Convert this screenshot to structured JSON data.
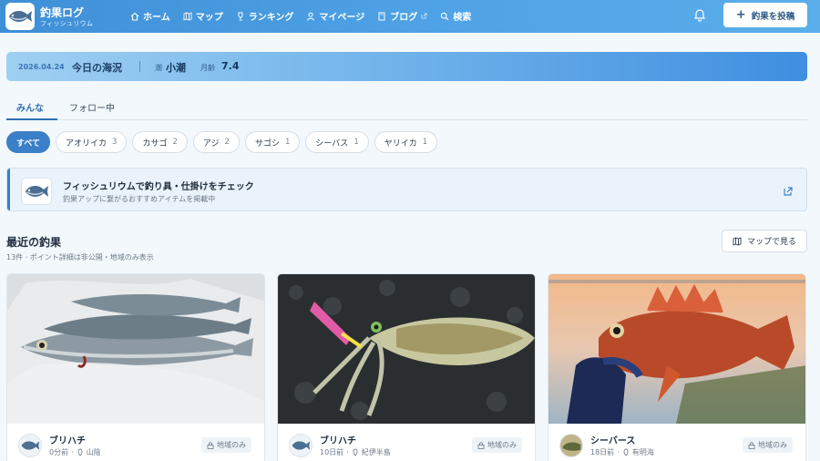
{
  "header": {
    "brand_title": "釣果ログ",
    "brand_sub": "フィッシュリウム",
    "nav": [
      {
        "label": "ホーム",
        "icon": "home-icon"
      },
      {
        "label": "マップ",
        "icon": "map-icon"
      },
      {
        "label": "ランキング",
        "icon": "trophy-icon"
      },
      {
        "label": "マイページ",
        "icon": "user-icon"
      },
      {
        "label": "ブログ",
        "icon": "book-icon"
      },
      {
        "label": "検索",
        "icon": "search-icon"
      }
    ],
    "post_button": "釣果を投稿",
    "colors": {
      "header_start": "#3f8fd6",
      "header_end": "#5aaeea"
    }
  },
  "today": {
    "date": "2026.04.24",
    "title": "今日の海況",
    "tide_label": "潮",
    "tide_value": "小潮",
    "moon_label": "月齢",
    "moon_value": "7.4"
  },
  "tabs": [
    {
      "label": "みんな",
      "active": true
    },
    {
      "label": "フォロー中",
      "active": false
    }
  ],
  "filters": [
    {
      "label": "すべて",
      "count": "",
      "active": true
    },
    {
      "label": "アオリイカ",
      "count": "3"
    },
    {
      "label": "カサゴ",
      "count": "2"
    },
    {
      "label": "アジ",
      "count": "2"
    },
    {
      "label": "サゴシ",
      "count": "1"
    },
    {
      "label": "シーバス",
      "count": "1"
    },
    {
      "label": "ヤリイカ",
      "count": "1"
    }
  ],
  "promo": {
    "title": "フィッシュリウムで釣り具・仕掛けをチェック",
    "description": "釣果アップに繋がるおすすめアイテムを掲載中"
  },
  "recent": {
    "title": "最近の釣果",
    "meta": "13件 · ポイント詳細は非公開・地域のみ表示",
    "map_button": "マップで見る"
  },
  "cards": [
    {
      "name": "ブリハチ",
      "time": "0分前",
      "location": "山陰",
      "badge": "地域のみ"
    },
    {
      "name": "ブリハチ",
      "time": "10日前",
      "location": "紀伊半島",
      "badge": "地域のみ"
    },
    {
      "name": "シーバース",
      "time": "18日前",
      "location": "有明海",
      "badge": "地域のみ"
    }
  ]
}
